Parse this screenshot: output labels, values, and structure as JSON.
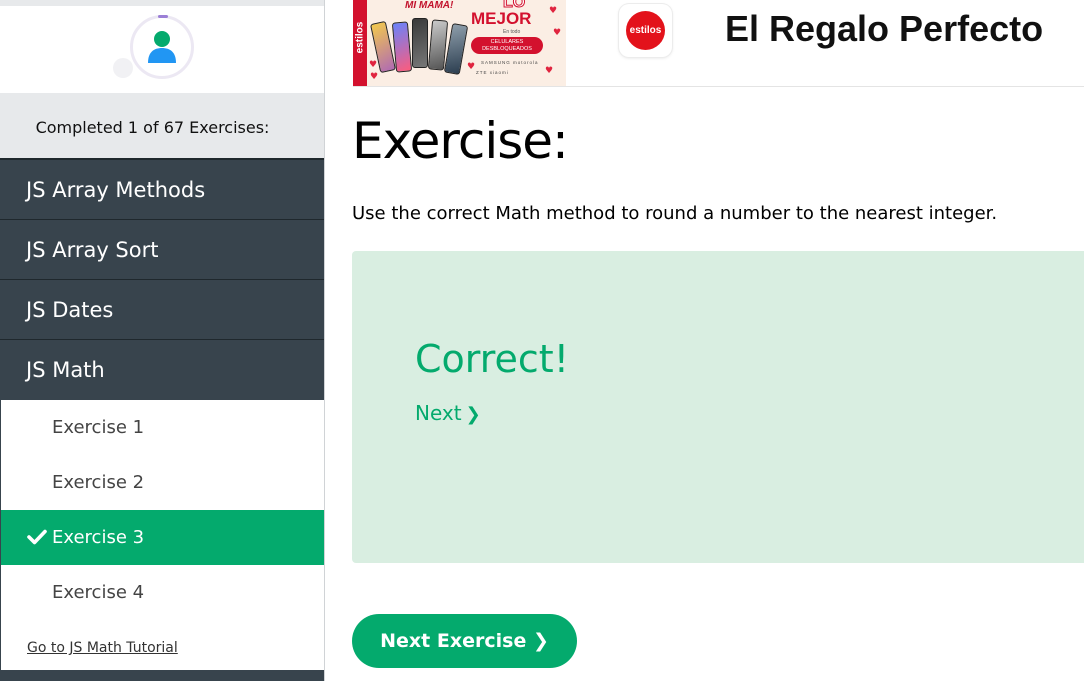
{
  "sidebar": {
    "progress_text": "Completed 1 of 67 Exercises:",
    "topics": [
      {
        "label": "JS Array Methods"
      },
      {
        "label": "JS Array Sort"
      },
      {
        "label": "JS Dates"
      },
      {
        "label": "JS Math"
      }
    ],
    "exercises": [
      {
        "label": "Exercise 1"
      },
      {
        "label": "Exercise 2"
      },
      {
        "label": "Exercise 3",
        "state": "completed-active"
      },
      {
        "label": "Exercise 4"
      }
    ],
    "tutorial_link": "Go to JS Math Tutorial"
  },
  "ad": {
    "side_text": "estilos",
    "tagline": "MI MAMÁ!",
    "lo": "LO",
    "mejor": "MEJOR",
    "small": "En todo",
    "pill": "CELULARES DESBLOQUEADOS",
    "brands_row1": "SAMSUNG motorola",
    "brands_row2": "ZTE xiaomi",
    "logo_text": "estilos",
    "headline": "El Regalo Perfecto"
  },
  "main": {
    "title": "Exercise:",
    "instruction": "Use the correct Math method to round a number to the nearest integer.",
    "result": {
      "status": "Correct!",
      "next_label": "Next",
      "next_icon": "chevron-right-icon"
    },
    "next_exercise_button": "Next Exercise ❯"
  },
  "colors": {
    "accent": "#04aa6d",
    "sidebar_dark": "#38444d",
    "result_bg": "#d9eee1",
    "brand_red": "#d3112e"
  }
}
